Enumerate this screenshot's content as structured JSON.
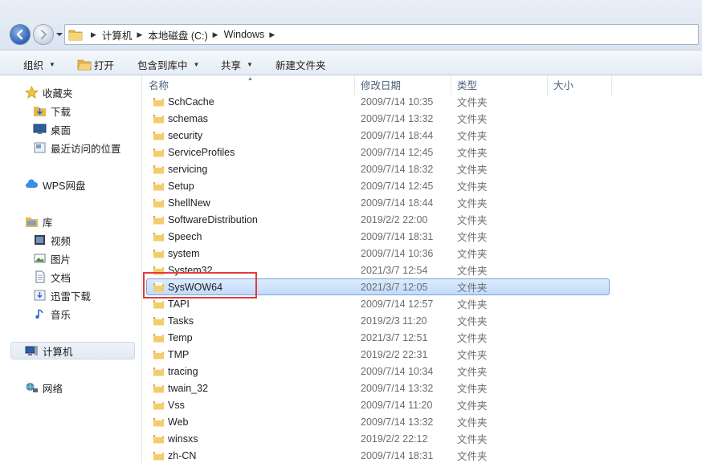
{
  "address_bar": {
    "crumbs": [
      "计算机",
      "本地磁盘 (C:)",
      "Windows"
    ]
  },
  "toolbar": {
    "organize": "组织",
    "open": "打开",
    "include_in_library": "包含到库中",
    "share": "共享",
    "new_folder": "新建文件夹"
  },
  "sidebar": {
    "favorites": "收藏夹",
    "downloads": "下载",
    "desktop": "桌面",
    "recent_places": "最近访问的位置",
    "wps_drive": "WPS网盘",
    "libraries": "库",
    "videos": "视频",
    "pictures": "图片",
    "documents": "文档",
    "xunlei": "迅雷下载",
    "music": "音乐",
    "computer": "计算机",
    "network": "网络"
  },
  "columns": {
    "name": "名称",
    "date": "修改日期",
    "type": "类型",
    "size": "大小"
  },
  "files": [
    {
      "name": "SchCache",
      "date": "2009/7/14 10:35",
      "type": "文件夹"
    },
    {
      "name": "schemas",
      "date": "2009/7/14 13:32",
      "type": "文件夹"
    },
    {
      "name": "security",
      "date": "2009/7/14 18:44",
      "type": "文件夹"
    },
    {
      "name": "ServiceProfiles",
      "date": "2009/7/14 12:45",
      "type": "文件夹"
    },
    {
      "name": "servicing",
      "date": "2009/7/14 18:32",
      "type": "文件夹"
    },
    {
      "name": "Setup",
      "date": "2009/7/14 12:45",
      "type": "文件夹"
    },
    {
      "name": "ShellNew",
      "date": "2009/7/14 18:44",
      "type": "文件夹"
    },
    {
      "name": "SoftwareDistribution",
      "date": "2019/2/2 22:00",
      "type": "文件夹"
    },
    {
      "name": "Speech",
      "date": "2009/7/14 18:31",
      "type": "文件夹"
    },
    {
      "name": "system",
      "date": "2009/7/14 10:36",
      "type": "文件夹"
    },
    {
      "name": "System32",
      "date": "2021/3/7 12:54",
      "type": "文件夹"
    },
    {
      "name": "SysWOW64",
      "date": "2021/3/7 12:05",
      "type": "文件夹",
      "selected": true
    },
    {
      "name": "TAPI",
      "date": "2009/7/14 12:57",
      "type": "文件夹"
    },
    {
      "name": "Tasks",
      "date": "2019/2/3 11:20",
      "type": "文件夹"
    },
    {
      "name": "Temp",
      "date": "2021/3/7 12:51",
      "type": "文件夹"
    },
    {
      "name": "TMP",
      "date": "2019/2/2 22:31",
      "type": "文件夹"
    },
    {
      "name": "tracing",
      "date": "2009/7/14 10:34",
      "type": "文件夹"
    },
    {
      "name": "twain_32",
      "date": "2009/7/14 13:32",
      "type": "文件夹"
    },
    {
      "name": "Vss",
      "date": "2009/7/14 11:20",
      "type": "文件夹"
    },
    {
      "name": "Web",
      "date": "2009/7/14 13:32",
      "type": "文件夹"
    },
    {
      "name": "winsxs",
      "date": "2019/2/2 22:12",
      "type": "文件夹"
    },
    {
      "name": "zh-CN",
      "date": "2009/7/14 18:31",
      "type": "文件夹"
    }
  ],
  "colors": {
    "highlight_box": "#e03d3d",
    "selection": "#c1dbfc",
    "folder": "#e8b84a"
  }
}
